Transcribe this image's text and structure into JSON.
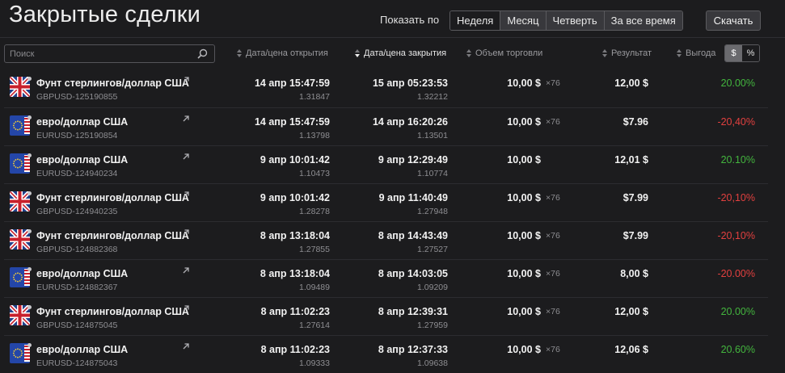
{
  "page": {
    "title": "Закрытые сделки",
    "show_label": "Показать по",
    "periods": [
      "Неделя",
      "Месяц",
      "Четверть",
      "За все время"
    ],
    "active_period": "Неделя",
    "download_label": "Скачать"
  },
  "table": {
    "search_placeholder": "Поиск",
    "columns": {
      "open": "Дата/цена открытия",
      "close": "Дата/цена закрытия",
      "volume": "Объем торговли",
      "result": "Результат",
      "profit": "Выгода"
    },
    "sorted_column": "close",
    "toggle": {
      "dollar": "$",
      "percent": "%",
      "active": "dollar"
    },
    "rows": [
      {
        "flag": "gb",
        "pair": "Фунт стерлингов/доллар США",
        "code": "GBPUSD-125190855",
        "open_time": "14 апр 15:47:59",
        "open_price": "1.31847",
        "close_time": "15 апр 05:23:53",
        "close_price": "1.32212",
        "volume": "10,00 $",
        "mult": "×76",
        "result": "12,00 $",
        "profit": "20.00%",
        "profit_sign": "pos"
      },
      {
        "flag": "eu",
        "pair": "евро/доллар США",
        "code": "EURUSD-125190854",
        "open_time": "14 апр 15:47:59",
        "open_price": "1.13798",
        "close_time": "14 апр 16:20:26",
        "close_price": "1.13501",
        "volume": "10,00 $",
        "mult": "×76",
        "result": "$7.96",
        "profit": "-20,40%",
        "profit_sign": "neg"
      },
      {
        "flag": "eu",
        "pair": "евро/доллар США",
        "code": "EURUSD-124940234",
        "open_time": "9 апр 10:01:42",
        "open_price": "1.10473",
        "close_time": "9 апр 12:29:49",
        "close_price": "1.10774",
        "volume": "10,00 $",
        "mult": "",
        "result": "12,01 $",
        "profit": "20.10%",
        "profit_sign": "pos"
      },
      {
        "flag": "gb",
        "pair": "Фунт стерлингов/доллар США",
        "code": "GBPUSD-124940235",
        "open_time": "9 апр 10:01:42",
        "open_price": "1.28278",
        "close_time": "9 апр 11:40:49",
        "close_price": "1.27948",
        "volume": "10,00 $",
        "mult": "×76",
        "result": "$7.99",
        "profit": "-20,10%",
        "profit_sign": "neg"
      },
      {
        "flag": "gb",
        "pair": "Фунт стерлингов/доллар США",
        "code": "GBPUSD-124882368",
        "open_time": "8 апр 13:18:04",
        "open_price": "1.27855",
        "close_time": "8 апр 14:43:49",
        "close_price": "1.27527",
        "volume": "10,00 $",
        "mult": "×76",
        "result": "$7.99",
        "profit": "-20,10%",
        "profit_sign": "neg"
      },
      {
        "flag": "eu",
        "pair": "евро/доллар США",
        "code": "EURUSD-124882367",
        "open_time": "8 апр 13:18:04",
        "open_price": "1.09489",
        "close_time": "8 апр 14:03:05",
        "close_price": "1.09209",
        "volume": "10,00 $",
        "mult": "×76",
        "result": "8,00 $",
        "profit": "-20.00%",
        "profit_sign": "neg"
      },
      {
        "flag": "gb",
        "pair": "Фунт стерлингов/доллар США",
        "code": "GBPUSD-124875045",
        "open_time": "8 апр 11:02:23",
        "open_price": "1.27614",
        "close_time": "8 апр 12:39:31",
        "close_price": "1.27959",
        "volume": "10,00 $",
        "mult": "×76",
        "result": "12,00 $",
        "profit": "20.00%",
        "profit_sign": "pos"
      },
      {
        "flag": "eu",
        "pair": "евро/доллар США",
        "code": "EURUSD-124875043",
        "open_time": "8 апр 11:02:23",
        "open_price": "1.09333",
        "close_time": "8 апр 12:37:33",
        "close_price": "1.09638",
        "volume": "10,00 $",
        "mult": "×76",
        "result": "12,06 $",
        "profit": "20.60%",
        "profit_sign": "pos"
      }
    ]
  }
}
